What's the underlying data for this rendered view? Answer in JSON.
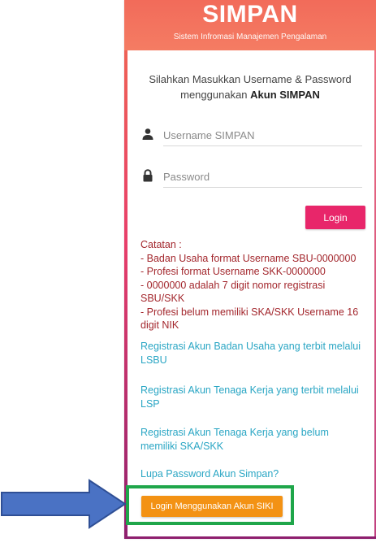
{
  "header": {
    "title": "SIMPAN",
    "subtitle": "Sistem Infromasi Manajemen Pengalaman"
  },
  "intro": {
    "line1": "Silahkan Masukkan Username & Password",
    "line2_prefix": "menggunakan ",
    "line2_bold": "Akun SIMPAN"
  },
  "form": {
    "username_placeholder": "Username SIMPAN",
    "password_placeholder": "Password",
    "login_label": "Login"
  },
  "notes": [
    "Catatan :",
    "- Badan Usaha format Username SBU-0000000",
    "- Profesi format Username SKK-0000000",
    "- 0000000 adalah 7 digit nomor registrasi SBU/SKK",
    "- Profesi belum memiliki SKA/SKK Username 16 digit NIK"
  ],
  "links": {
    "reg_badan_usaha": "Registrasi Akun Badan Usaha yang terbit melalui LSBU",
    "reg_tenaga_kerja_lsp": "Registrasi Akun Tenaga Kerja yang terbit melalui LSP",
    "reg_tenaga_kerja_belum": "Registrasi Akun Tenaga Kerja yang belum memiliki SKA/SKK",
    "lupa_password": "Lupa Password Akun Simpan?"
  },
  "siki_button_label": "Login Menggunakan Akun SIKI",
  "icons": {
    "user": "user-icon",
    "lock": "lock-icon",
    "arrow": "arrow-right-icon"
  },
  "colors": {
    "header": "#f26b5a",
    "login_button": "#e8266a",
    "siki_button": "#f39214",
    "highlight_frame": "#1fa64a",
    "arrow": "#4a72c4",
    "notes_text": "#a3272d",
    "link_text": "#2aa6c4"
  }
}
